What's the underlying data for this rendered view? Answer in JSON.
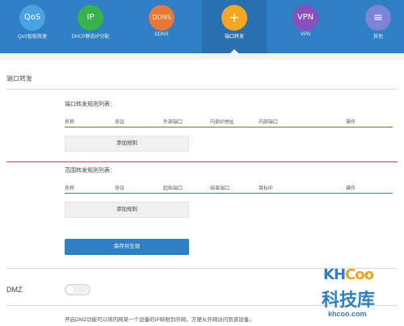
{
  "nav": {
    "items": [
      {
        "icon_text": "QoS",
        "label": "QoS智能限速",
        "color": "#4aa3e0",
        "active": false
      },
      {
        "icon_text": "IP",
        "label": "DHCP静态IP分配",
        "color": "#37b24d",
        "active": false
      },
      {
        "icon_text": "DDNS",
        "label": "DDNS",
        "color": "#e8773c",
        "active": false
      },
      {
        "icon_text": "+",
        "label": "端口转发",
        "color": "#f5a623",
        "active": true
      },
      {
        "icon_text": "VPN",
        "label": "VPN",
        "color": "#8a4fbf",
        "active": false
      },
      {
        "icon_text": "≡",
        "label": "其他",
        "color": "#7b84d6",
        "active": false
      }
    ]
  },
  "section": {
    "title": "端口转发"
  },
  "port_forward": {
    "list_title": "端口转发规则列表：",
    "headers": [
      "名称",
      "协议",
      "外部端口",
      "内部IP地址",
      "内部端口",
      "操作"
    ],
    "add_label": "添加规则"
  },
  "range_forward": {
    "list_title": "范围转发规则列表：",
    "headers": [
      "名称",
      "协议",
      "起始端口",
      "结束端口",
      "目标IP",
      "操作"
    ],
    "add_label": "添加规则"
  },
  "save_label": "保存并生效",
  "dmz": {
    "label": "DMZ",
    "enabled": false,
    "description": "开启DMZ功能可以将内网某一个设备的IP映射到外网，方便从外网访问到该设备。"
  },
  "watermark": {
    "logo_kh": "KH",
    "logo_coo": "Coo",
    "cn": "科技库",
    "url": "khcoo.com"
  },
  "colors": {
    "brand": "#2f7fc4",
    "save": "#2f7fc4",
    "divider_red": "#d9534f"
  }
}
